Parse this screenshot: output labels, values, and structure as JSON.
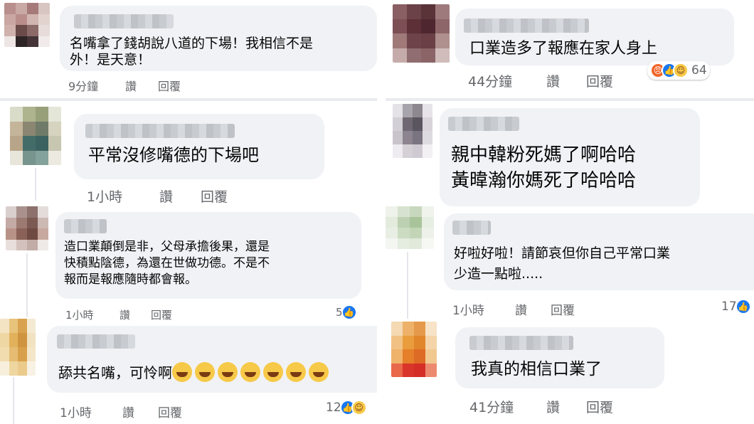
{
  "left": {
    "c1": {
      "text": "名嘴拿了錢胡說八道的下場！我相信不是\n外！是天意！",
      "time": "9分鐘",
      "like": "讚",
      "reply": "回覆"
    },
    "c2": {
      "text": "平常沒修嘴德的下場吧",
      "time": "1小時",
      "like": "讚",
      "reply": "回覆"
    },
    "c3": {
      "text": "造口業顛倒是非，父母承擔後果，還是\n快積點陰德，為還在世做功德。不是不\n報而是報應隨時都會報。",
      "time": "1小時",
      "like": "讚",
      "reply": "回覆",
      "reaction_count": "5",
      "reaction_icons": [
        "like-icon"
      ]
    },
    "c4": {
      "text": "舔共名嘴，可怜啊",
      "emojis": [
        "rofl-emoji",
        "joy-emoji",
        "joy-emoji",
        "joy-emoji",
        "joy-emoji",
        "rofl-emoji",
        "rofl-emoji"
      ],
      "time": "1小時",
      "like": "讚",
      "reply": "回覆",
      "reaction_count": "12",
      "reaction_icons": [
        "like-icon",
        "haha-icon"
      ]
    }
  },
  "right": {
    "c1": {
      "text": "口業造多了報應在家人身上",
      "time": "44分鐘",
      "like": "讚",
      "reply": "回覆",
      "reaction_count": "64",
      "reaction_icons": [
        "angry-icon",
        "like-icon",
        "haha-icon"
      ]
    },
    "c2": {
      "text": "親中韓粉死媽了啊哈哈\n黃暐瀚你媽死了哈哈哈"
    },
    "c3": {
      "text": "好啦好啦！請節哀但你自己平常口業\n少造一點啦.....",
      "time": "1小時",
      "like": "讚",
      "reply": "回覆",
      "reaction_count": "17",
      "reaction_icons": [
        "like-icon"
      ]
    },
    "c4": {
      "text": "我真的相信口業了",
      "time": "41分鐘",
      "like": "讚",
      "reply": "回覆"
    }
  },
  "colors": {
    "bubble": "#f0f2f5",
    "meta": "#65676b",
    "like_blue": "#1877f2",
    "haha_yellow": "#f7c948",
    "angry_orange": "#f0662a"
  }
}
